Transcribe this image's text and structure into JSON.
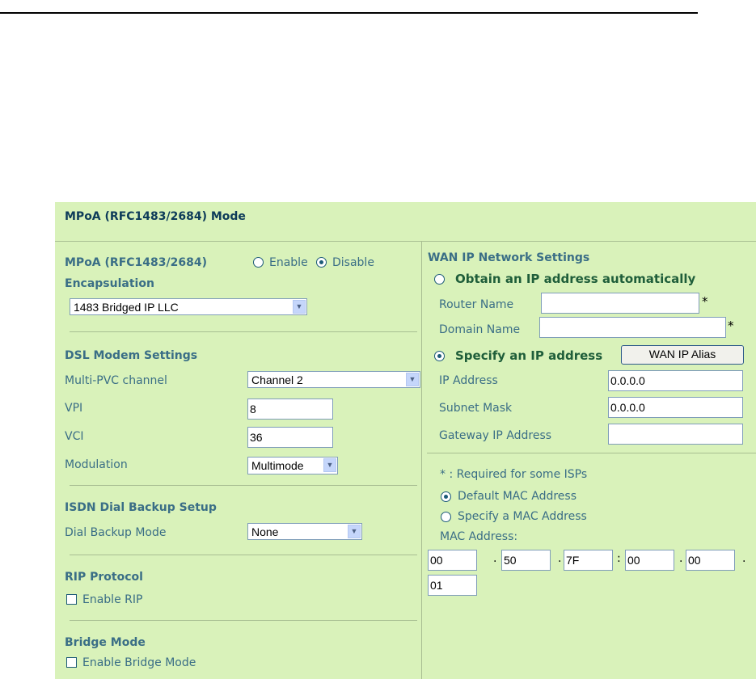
{
  "panel_title": "MPoA (RFC1483/2684) Mode",
  "mpoa": {
    "label": "MPoA (RFC1483/2684)",
    "enable_label": "Enable",
    "disable_label": "Disable",
    "selected": "Disable"
  },
  "encapsulation": {
    "heading": "Encapsulation",
    "value": "1483 Bridged IP LLC"
  },
  "dsl": {
    "heading": "DSL Modem Settings",
    "multi_pvc_label": "Multi-PVC channel",
    "multi_pvc_value": "Channel 2",
    "vpi_label": "VPI",
    "vpi_value": "8",
    "vci_label": "VCI",
    "vci_value": "36",
    "modulation_label": "Modulation",
    "modulation_value": "Multimode"
  },
  "isdn": {
    "heading": "ISDN Dial Backup Setup",
    "mode_label": "Dial Backup Mode",
    "mode_value": "None"
  },
  "rip": {
    "heading": "RIP Protocol",
    "enable_label": "Enable RIP",
    "checked": false
  },
  "bridge": {
    "heading": "Bridge Mode",
    "enable_label": "Enable Bridge Mode",
    "checked": false
  },
  "wan": {
    "heading": "WAN IP Network Settings",
    "obtain_label": "Obtain an IP address automatically",
    "router_name_label": "Router Name",
    "router_name_value": "",
    "domain_name_label": "Domain Name",
    "domain_name_value": "",
    "required_mark": "*",
    "specify_label": "Specify an IP address",
    "alias_button": "WAN IP Alias",
    "ip_label": "IP Address",
    "ip_value": "0.0.0.0",
    "subnet_label": "Subnet Mask",
    "subnet_value": "0.0.0.0",
    "gateway_label": "Gateway IP Address",
    "gateway_value": "",
    "selected": "Specify an IP address"
  },
  "mac": {
    "note": "* : Required for some ISPs",
    "default_label": "Default MAC Address",
    "specify_label": "Specify a MAC Address",
    "address_label": "MAC Address:",
    "octets": [
      "00",
      "50",
      "7F",
      "00",
      "00",
      "01"
    ],
    "separators": [
      ".",
      ".",
      ":",
      ".",
      "."
    ],
    "selected": "Default MAC Address"
  },
  "colors": {
    "panel_bg": "#d9f2ba",
    "heading": "#0d3b59",
    "label": "#3a6e86"
  }
}
